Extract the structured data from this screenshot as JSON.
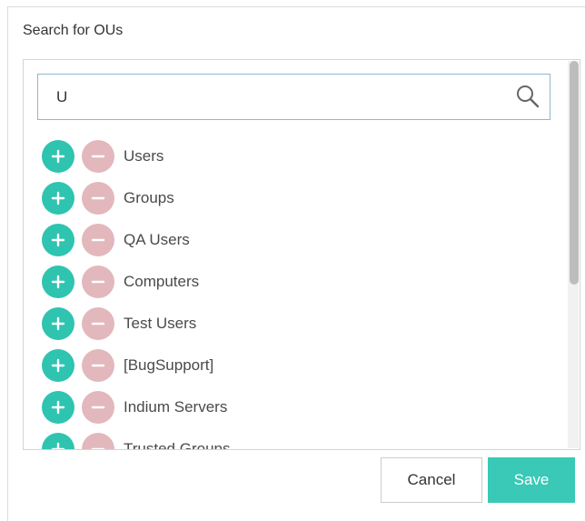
{
  "dialog": {
    "title": "Search for OUs"
  },
  "search": {
    "value": "U",
    "icon": "search-icon"
  },
  "ou_list": {
    "items": [
      {
        "label": "Users"
      },
      {
        "label": "Groups"
      },
      {
        "label": "QA Users"
      },
      {
        "label": "Computers"
      },
      {
        "label": "Test Users"
      },
      {
        "label": "[BugSupport]"
      },
      {
        "label": "Indium Servers"
      },
      {
        "label": "Trusted Groups"
      }
    ],
    "add_icon": "plus-icon",
    "remove_icon": "minus-icon"
  },
  "footer": {
    "cancel_label": "Cancel",
    "save_label": "Save"
  },
  "colors": {
    "add_button": "#2ec4b0",
    "remove_button": "#e2b8bc",
    "save_button": "#39c9b6",
    "search_border": "#8fb8cc"
  }
}
